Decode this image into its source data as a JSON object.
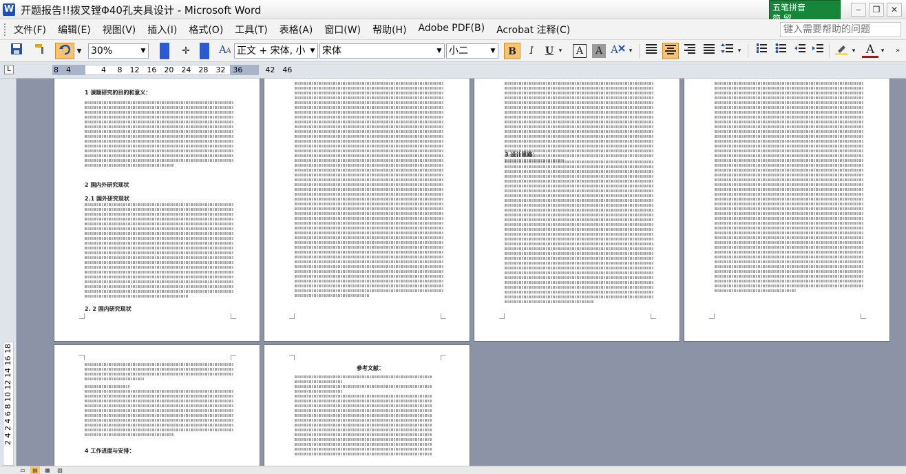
{
  "window": {
    "title": "开题报告!!拨叉镗Φ40孔夹具设计 - Microsoft Word",
    "app_icon": "W"
  },
  "ime": {
    "row1": "五笔拼音",
    "row2": "简 留"
  },
  "window_controls": {
    "minimize": "‒",
    "restore": "❐",
    "close": "✕"
  },
  "menu": {
    "items": [
      "文件(F)",
      "编辑(E)",
      "视图(V)",
      "插入(I)",
      "格式(O)",
      "工具(T)",
      "表格(A)",
      "窗口(W)",
      "帮助(H)",
      "Adobe PDF(B)",
      "Acrobat 注释(C)"
    ],
    "help_placeholder": "键入需要帮助的问题"
  },
  "toolbar": {
    "zoom": "30%",
    "style": "正文 + 宋体, 小",
    "font": "宋体",
    "size": "小二",
    "bold": "B",
    "italic": "I",
    "underline": "U",
    "char_border": "A",
    "char_shade": "A",
    "font_color": "A"
  },
  "ruler": {
    "numbers": "8  4        4   8  12  16  20  24  28  32  36      42  46"
  },
  "vruler": {
    "numbers": "2 4     2  4  6  8 10 12 14 16 18"
  },
  "pages": {
    "p1": {
      "h1": "1  课题研究的目的和意义：",
      "h2": "2  国内外研究现状",
      "h3": "2.1 国外研究现状",
      "h4": "2. 2 国内研究现状"
    },
    "p3": {
      "h1": "3  设计思路："
    },
    "p5": {
      "h1": "4  工作进度与安排："
    },
    "p6": {
      "h1": "参考文献："
    }
  },
  "statusbar": {
    "views": [
      "▭",
      "▤",
      "▦",
      "▧"
    ]
  }
}
